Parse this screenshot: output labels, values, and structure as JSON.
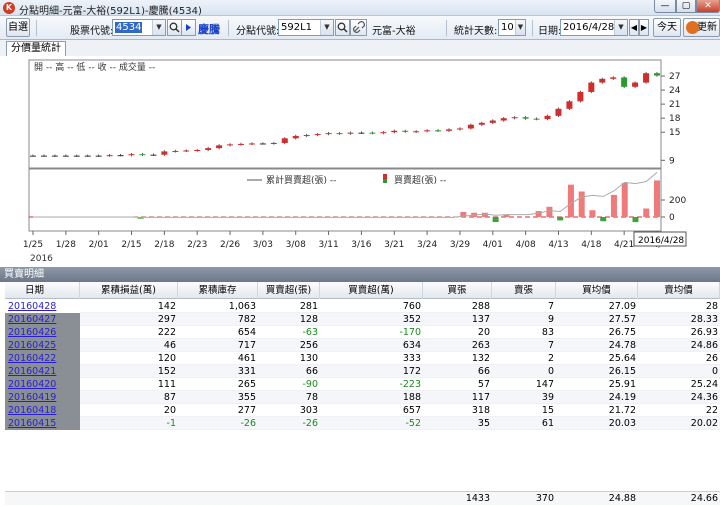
{
  "window": {
    "title": "分點明細-元富-大裕(592L1)-慶騰(4534)",
    "min": "—",
    "max": "▢",
    "close": "✕"
  },
  "toolbar": {
    "select_button": "自選",
    "stock_code_label": "股票代號:",
    "stock_code_value": "4534",
    "stock_name": "慶騰",
    "branch_code_label": "分點代號:",
    "branch_code_value": "592L1",
    "branch_name": "元富-大裕",
    "stat_days_label": "統計天數:",
    "stat_days_value": "10",
    "date_label": "日期:",
    "date_value": "2016/4/28",
    "today_button": "今天",
    "refresh_button": "更新"
  },
  "tabs": [
    {
      "label": "分價量統計"
    }
  ],
  "chart": {
    "price_legend": "開 -- 高 -- 低 -- 收 -- 成交量 --",
    "lower_legend_cum": "累計買賣超(張) --",
    "lower_legend_net": "買賣超(張) --",
    "date_tooltip": "2016/4/28",
    "x_year": "2016"
  },
  "chart_data": {
    "type": "candlestick",
    "price_axis_ticks": [
      27,
      24,
      21,
      18,
      15,
      9
    ],
    "lower_axis_ticks": [
      200,
      0
    ],
    "x_tick_labels": [
      "1/25",
      "1/28",
      "2/01",
      "2/15",
      "2/18",
      "2/23",
      "2/26",
      "3/03",
      "3/08",
      "3/11",
      "3/16",
      "3/21",
      "3/24",
      "3/29",
      "4/01",
      "4/08",
      "4/13",
      "4/18",
      "4/21",
      "4/"
    ],
    "close_prices": [
      10.0,
      10.0,
      10.0,
      10.0,
      10.0,
      10.0,
      10.0,
      10.1,
      10.1,
      10.3,
      10.2,
      10.2,
      10.9,
      11.0,
      11.1,
      11.2,
      11.6,
      12.2,
      12.4,
      12.5,
      12.6,
      12.6,
      12.7,
      13.7,
      14.2,
      14.4,
      14.6,
      14.8,
      14.7,
      14.9,
      14.9,
      14.8,
      15.0,
      15.3,
      15.1,
      15.2,
      15.4,
      15.3,
      15.6,
      15.8,
      16.6,
      17.0,
      17.5,
      18.0,
      18.2,
      17.9,
      17.8,
      18.5,
      20.0,
      21.6,
      23.6,
      25.6,
      26.4,
      26.7,
      24.7,
      25.6,
      27.6,
      27.1
    ],
    "net_buy_values": [
      0,
      0,
      0,
      0,
      0,
      0,
      0,
      0,
      0,
      0,
      -20,
      0,
      0,
      0,
      0,
      0,
      0,
      0,
      0,
      0,
      0,
      0,
      0,
      0,
      0,
      0,
      0,
      0,
      0,
      0,
      0,
      0,
      0,
      0,
      0,
      0,
      0,
      0,
      0,
      0,
      60,
      50,
      50,
      -60,
      30,
      0,
      0,
      70,
      120,
      -40,
      380,
      300,
      80,
      -50,
      260,
      400,
      -60,
      100,
      430
    ]
  },
  "detail_header": "買賣明細",
  "table": {
    "columns": [
      "日期",
      "累積損益(萬)",
      "累積庫存",
      "買賣超(張)",
      "買賣超(萬)",
      "買張",
      "賣張",
      "買均價",
      "賣均價"
    ],
    "rows": [
      [
        "20160428",
        "142",
        "1,063",
        "281",
        "760",
        "288",
        "7",
        "27.09",
        "28"
      ],
      [
        "20160427",
        "297",
        "782",
        "128",
        "352",
        "137",
        "9",
        "27.57",
        "28.33"
      ],
      [
        "20160426",
        "222",
        "654",
        "-63",
        "-170",
        "20",
        "83",
        "26.75",
        "26.93"
      ],
      [
        "20160425",
        "46",
        "717",
        "256",
        "634",
        "263",
        "7",
        "24.78",
        "24.86"
      ],
      [
        "20160422",
        "120",
        "461",
        "130",
        "333",
        "132",
        "2",
        "25.64",
        "26"
      ],
      [
        "20160421",
        "152",
        "331",
        "66",
        "172",
        "66",
        "0",
        "26.15",
        "0"
      ],
      [
        "20160420",
        "111",
        "265",
        "-90",
        "-223",
        "57",
        "147",
        "25.91",
        "25.24"
      ],
      [
        "20160419",
        "87",
        "355",
        "78",
        "188",
        "117",
        "39",
        "24.19",
        "24.36"
      ],
      [
        "20160418",
        "20",
        "277",
        "303",
        "657",
        "318",
        "15",
        "21.72",
        "22"
      ],
      [
        "20160415",
        "-1",
        "-26",
        "-26",
        "-52",
        "35",
        "61",
        "20.03",
        "20.02"
      ]
    ],
    "totals": [
      "",
      "",
      "",
      "",
      "",
      "1433",
      "370",
      "24.88",
      "24.66"
    ]
  }
}
